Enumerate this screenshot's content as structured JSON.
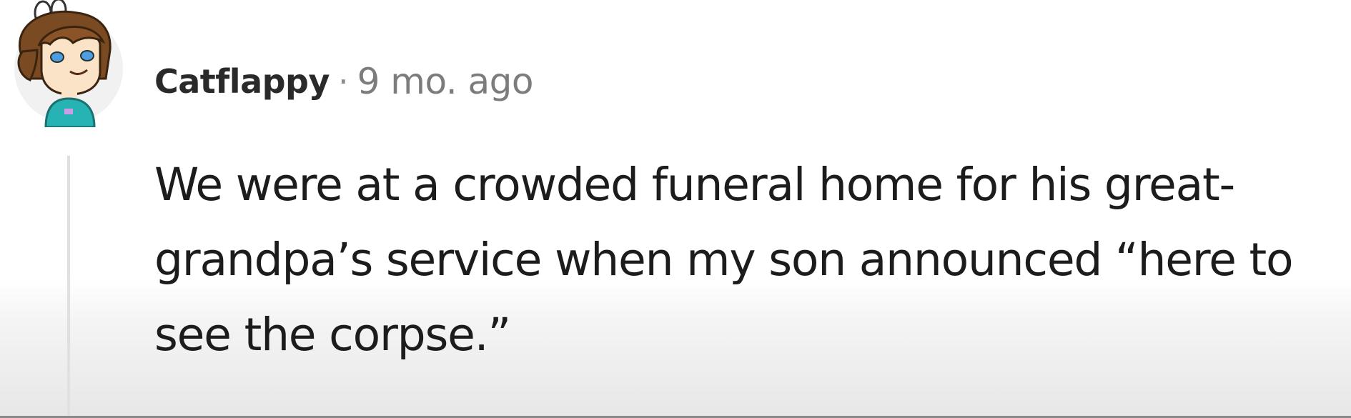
{
  "comment": {
    "author": "Catflappy",
    "separator": "·",
    "timestamp": "9 mo. ago",
    "body": "We were at a crowded funeral home for his great-grandpa’s service when my son announced “here to see the corpse.”"
  },
  "colors": {
    "author_text": "#2a2a2a",
    "timestamp_text": "#7c7c7c",
    "body_text": "#1c1c1c",
    "thread_line": "#e0e0e0",
    "avatar_hair": "#7a4a22",
    "avatar_shirt": "#27b3b3"
  },
  "icons": {
    "avatar": "user-avatar-icon"
  }
}
